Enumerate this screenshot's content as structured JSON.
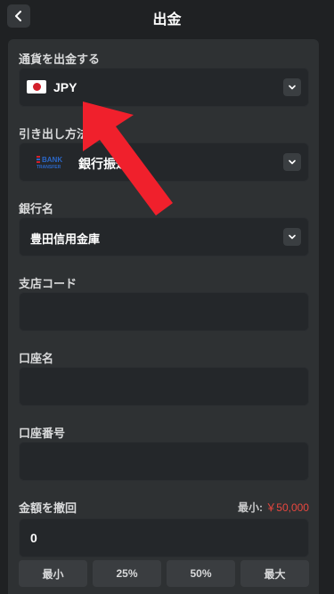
{
  "header": {
    "title": "出金"
  },
  "currency": {
    "label": "通貨を出金する",
    "value": "JPY",
    "flag": "japan-flag"
  },
  "method": {
    "label": "引き出し方法",
    "value": "銀行振込",
    "logo_line1": "BANK",
    "logo_line2": "TRANSFER"
  },
  "bank": {
    "label": "銀行名",
    "value": "豊田信用金庫"
  },
  "branch": {
    "label": "支店コード",
    "value": ""
  },
  "account_name": {
    "label": "口座名",
    "value": ""
  },
  "account_number": {
    "label": "口座番号",
    "value": ""
  },
  "amount": {
    "label": "金額を撤回",
    "min_prefix": "最小:",
    "min_value": "￥50,000",
    "value": "0",
    "quick": [
      "最小",
      "25%",
      "50%",
      "最大"
    ]
  },
  "colors": {
    "accent_red": "#e8473f",
    "arrow": "#f0202c",
    "flag_red": "#d31f2a"
  }
}
